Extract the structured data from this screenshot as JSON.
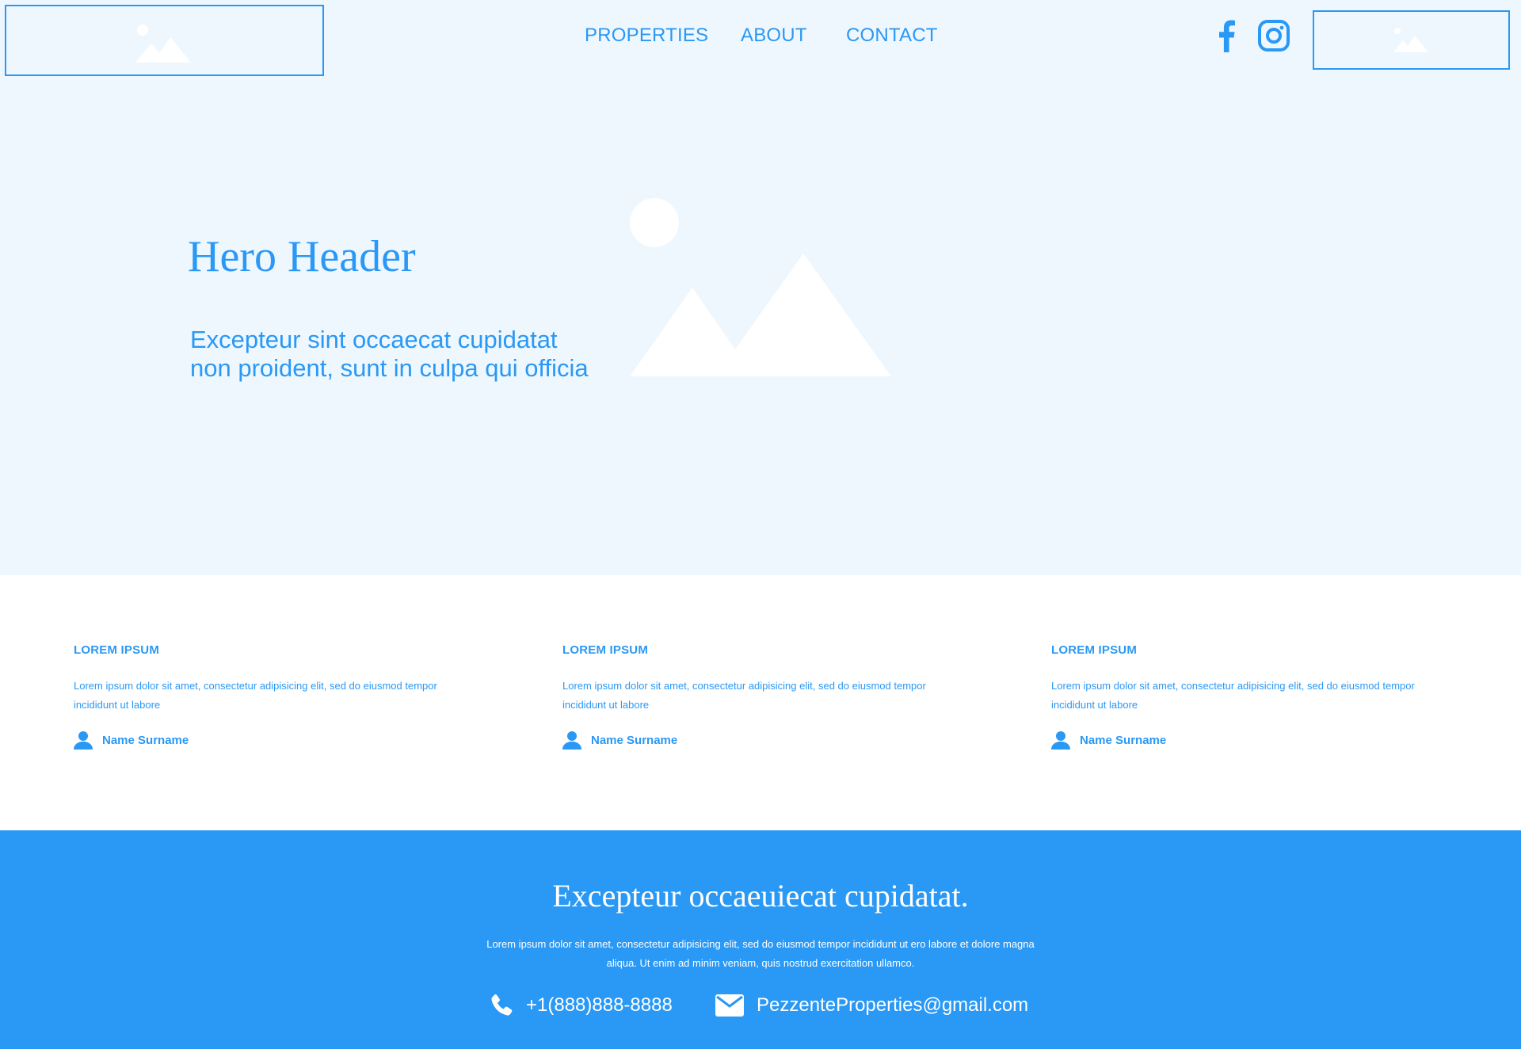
{
  "header": {
    "logo_icon": "image-placeholder-icon",
    "nav": {
      "properties": "PROPERTIES",
      "about": "ABOUT",
      "contact": "CONTACT"
    },
    "social": [
      "facebook-icon",
      "instagram-icon"
    ],
    "cta_icon": "image-placeholder-icon"
  },
  "hero": {
    "title": "Hero Header",
    "subtitle": "Excepteur sint occaecat cupidatat non proident, sunt in culpa qui officia",
    "image_icon": "image-placeholder-icon"
  },
  "cards": [
    {
      "title": "LOREM IPSUM",
      "body": "Lorem ipsum dolor sit amet, consectetur adipisicing elit, sed do eiusmod tempor incididunt ut labore",
      "author": "Name Surname"
    },
    {
      "title": "LOREM IPSUM",
      "body": "Lorem ipsum dolor sit amet, consectetur adipisicing elit, sed do eiusmod tempor incididunt ut labore",
      "author": "Name Surname"
    },
    {
      "title": "LOREM IPSUM",
      "body": "Lorem ipsum dolor sit amet, consectetur adipisicing elit, sed do eiusmod tempor incididunt ut labore",
      "author": "Name Surname"
    }
  ],
  "footer": {
    "title": "Excepteur occaeuiecat cupidatat.",
    "text": "Lorem ipsum dolor sit amet, consectetur adipisicing elit, sed do eiusmod tempor incididunt ut ero labore et dolore magna aliqua. Ut enim ad minim veniam, quis nostrud exercitation ullamco.",
    "phone": "+1(888)888-8888",
    "email": "PezzenteProperties@gmail.com"
  },
  "colors": {
    "accent": "#2a98f5",
    "hero_background": "#eef7fe",
    "footer_background": "#2a98f5"
  }
}
